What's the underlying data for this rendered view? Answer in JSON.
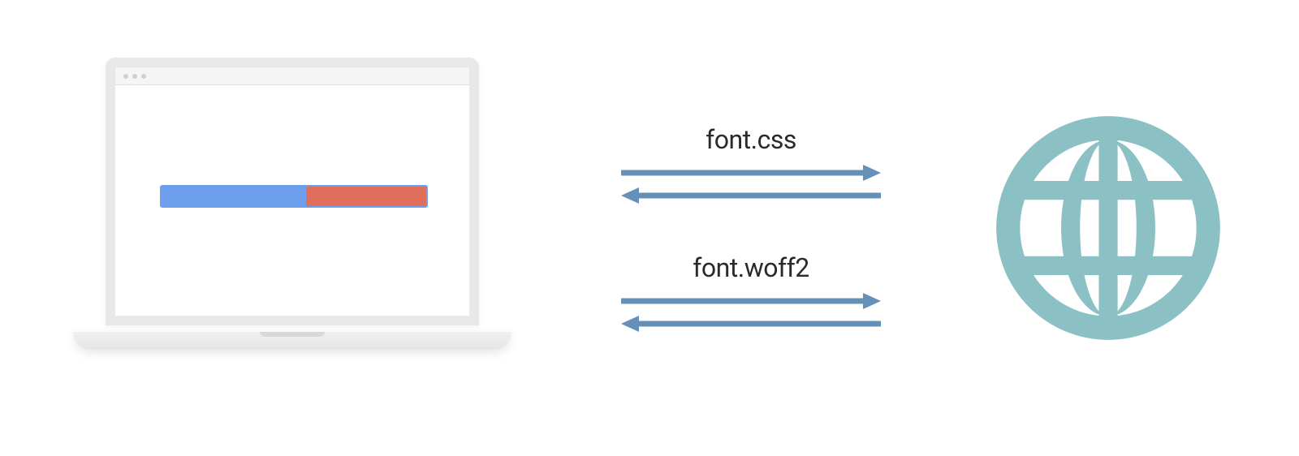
{
  "diagram": {
    "requests": [
      {
        "label": "font.css"
      },
      {
        "label": "font.woff2"
      }
    ],
    "progress": {
      "loaded_color": "#6d9fed",
      "pending_color": "#e06e5d",
      "pending_percent": 45
    },
    "colors": {
      "arrow": "#6591b8",
      "globe": "#8bc0c5",
      "laptop_bezel": "#e8e8e8"
    }
  }
}
